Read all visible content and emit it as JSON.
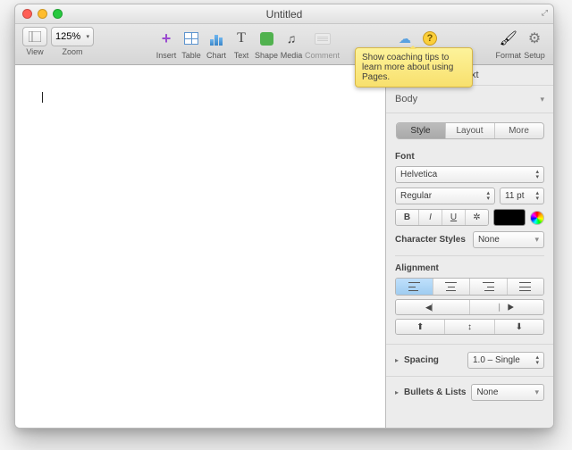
{
  "window": {
    "title": "Untitled"
  },
  "toolbar": {
    "view": "View",
    "zoom_label": "Zoom",
    "zoom_value": "125%",
    "insert": "Insert",
    "table": "Table",
    "chart": "Chart",
    "text": "Text",
    "shape": "Shape",
    "media": "Media",
    "comment": "Comment",
    "share": "Share",
    "tips": "Tips",
    "format": "Format",
    "setup": "Setup"
  },
  "tooltip": "Show coaching tips to learn more about using Pages.",
  "sidebar": {
    "title": "Text",
    "paragraph_style": "Body",
    "tabs": {
      "style": "Style",
      "layout": "Layout",
      "more": "More"
    },
    "font": {
      "label": "Font",
      "family": "Helvetica",
      "weight": "Regular",
      "size": "11 pt",
      "bold": "B",
      "italic": "I",
      "underline": "U",
      "gear": "✿"
    },
    "character_styles": {
      "label": "Character Styles",
      "value": "None"
    },
    "alignment": {
      "label": "Alignment"
    },
    "spacing": {
      "label": "Spacing",
      "value": "1.0 – Single"
    },
    "bullets": {
      "label": "Bullets & Lists",
      "value": "None"
    }
  }
}
